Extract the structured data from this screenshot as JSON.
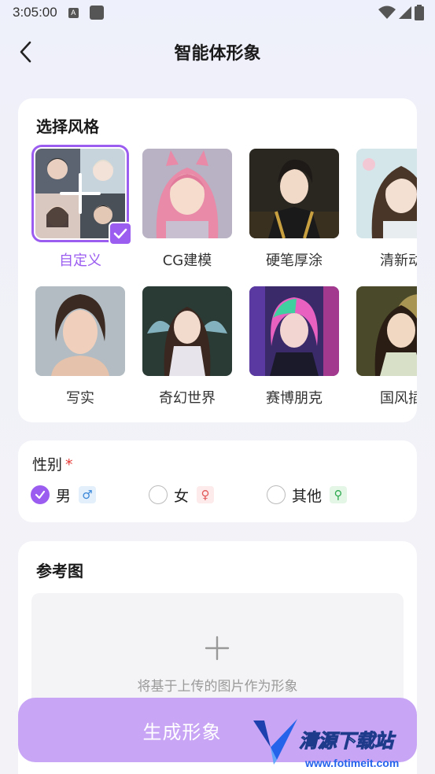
{
  "status_bar": {
    "time": "3:05:00",
    "a_icon_letter": "A"
  },
  "nav": {
    "title": "智能体形象"
  },
  "style_section": {
    "title": "选择风格",
    "items": [
      {
        "label": "自定义",
        "selected": true
      },
      {
        "label": "CG建模"
      },
      {
        "label": "硬笔厚涂"
      },
      {
        "label": "清新动"
      },
      {
        "label": "写实"
      },
      {
        "label": "奇幻世界"
      },
      {
        "label": "赛博朋克"
      },
      {
        "label": "国风插"
      }
    ]
  },
  "gender_section": {
    "label": "性别",
    "required_mark": "*",
    "options": [
      {
        "label": "男",
        "symbol": "♂",
        "checked": true
      },
      {
        "label": "女",
        "symbol": "♀"
      },
      {
        "label": "其他",
        "symbol": "⚲"
      }
    ]
  },
  "reference_section": {
    "title": "参考图",
    "upload_hint": "将基于上传的图片作为形象"
  },
  "generate_button": {
    "label": "生成形象"
  },
  "watermark": {
    "text": "清源下载站",
    "url": "www.fotimeit.com"
  },
  "colors": {
    "accent": "#9b5cf0",
    "button": "#c8a6f5",
    "required": "#e53935"
  }
}
